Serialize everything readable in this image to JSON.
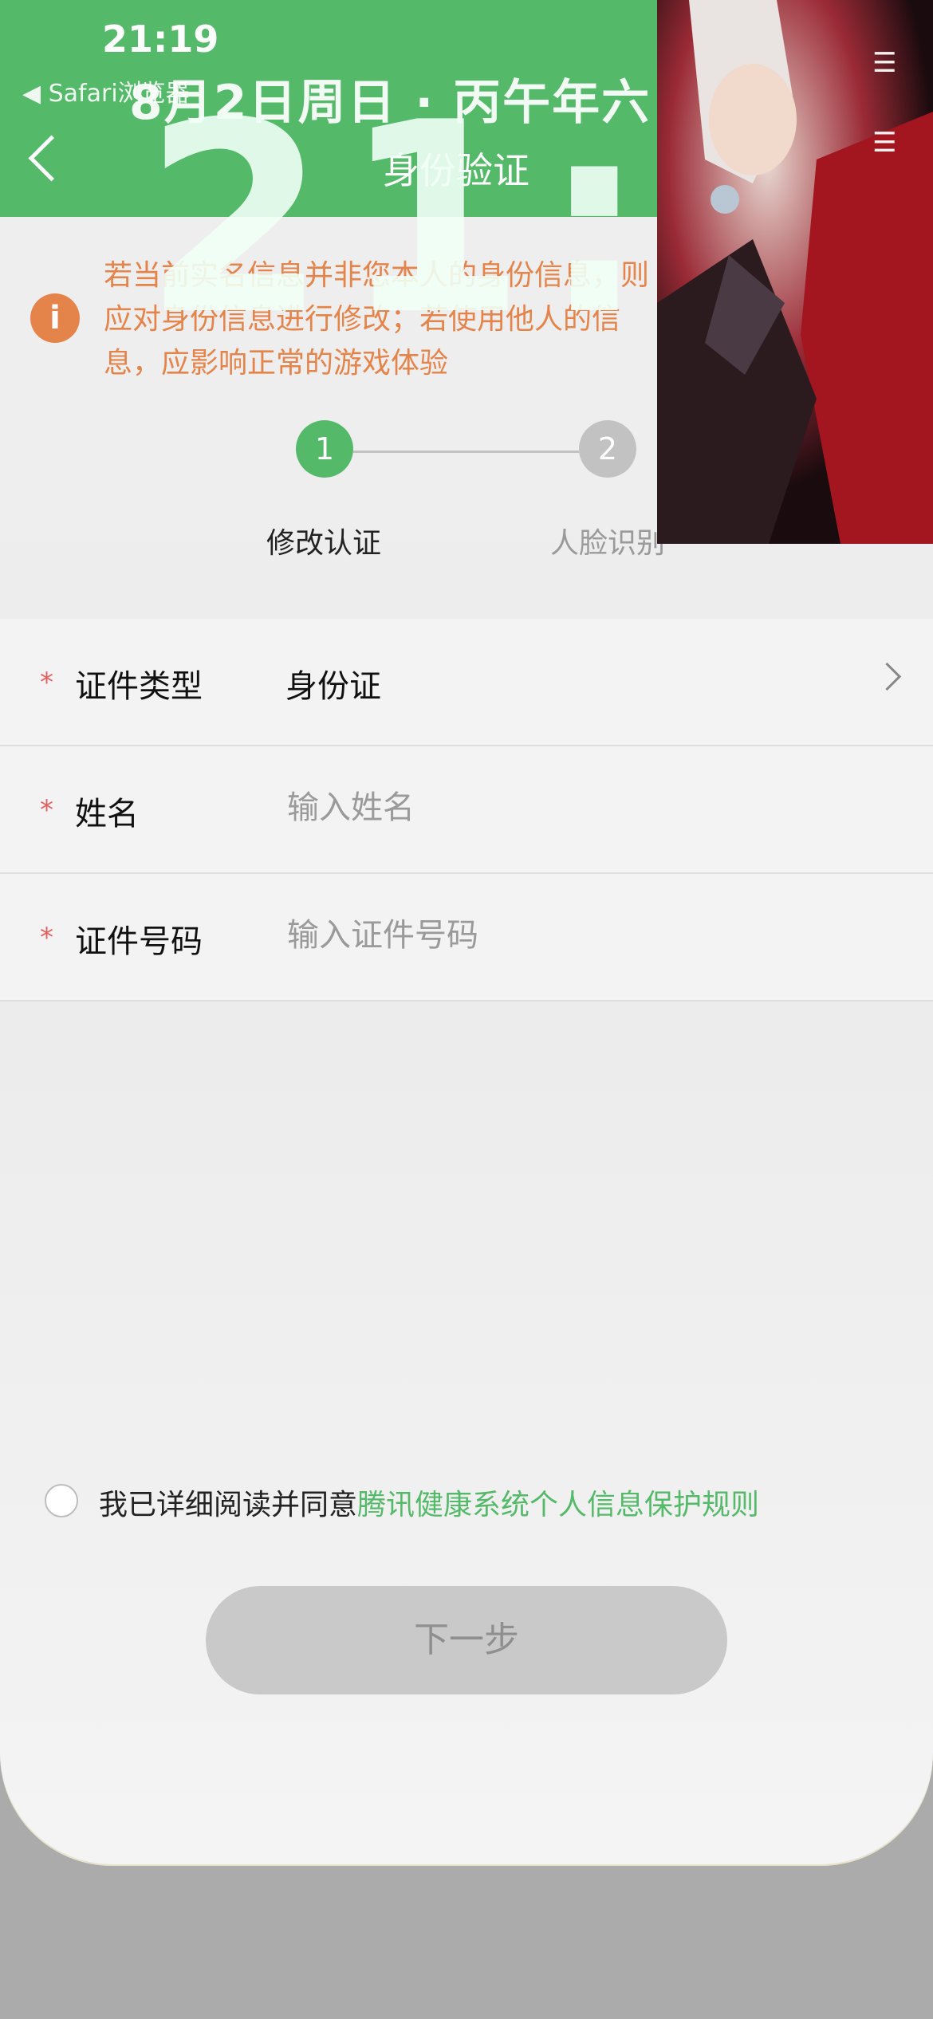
{
  "status_bar": {
    "time": "21:19",
    "back_app": "◀ Safari浏览器"
  },
  "lock_overlay": {
    "date": "8月2日周日 · 丙午年六",
    "big_time": "21:19"
  },
  "nav": {
    "title": "身份验证"
  },
  "notice": {
    "icon": "info-icon",
    "text": "若当前实名信息并非您本人的身份信息，则应对身份信息进行修改；若使用他人的信息，应影响正常的游戏体验"
  },
  "steps": [
    {
      "number": "1",
      "label": "修改认证",
      "active": true
    },
    {
      "number": "2",
      "label": "人脸识别",
      "active": false
    }
  ],
  "form": {
    "id_type": {
      "label": "证件类型",
      "value": "身份证"
    },
    "name": {
      "label": "姓名",
      "placeholder": "输入姓名"
    },
    "id_number": {
      "label": "证件号码",
      "placeholder": "输入证件号码"
    },
    "required_mark": "*"
  },
  "agreement": {
    "text": "我已详细阅读并同意",
    "link": "腾讯健康系统个人信息保护规则"
  },
  "next_button": {
    "label": "下一步"
  },
  "colors": {
    "brand_green": "#55b96a",
    "notice_orange": "#e4844a",
    "required_red": "#e06060",
    "disabled_button": "#c9c9c9"
  }
}
